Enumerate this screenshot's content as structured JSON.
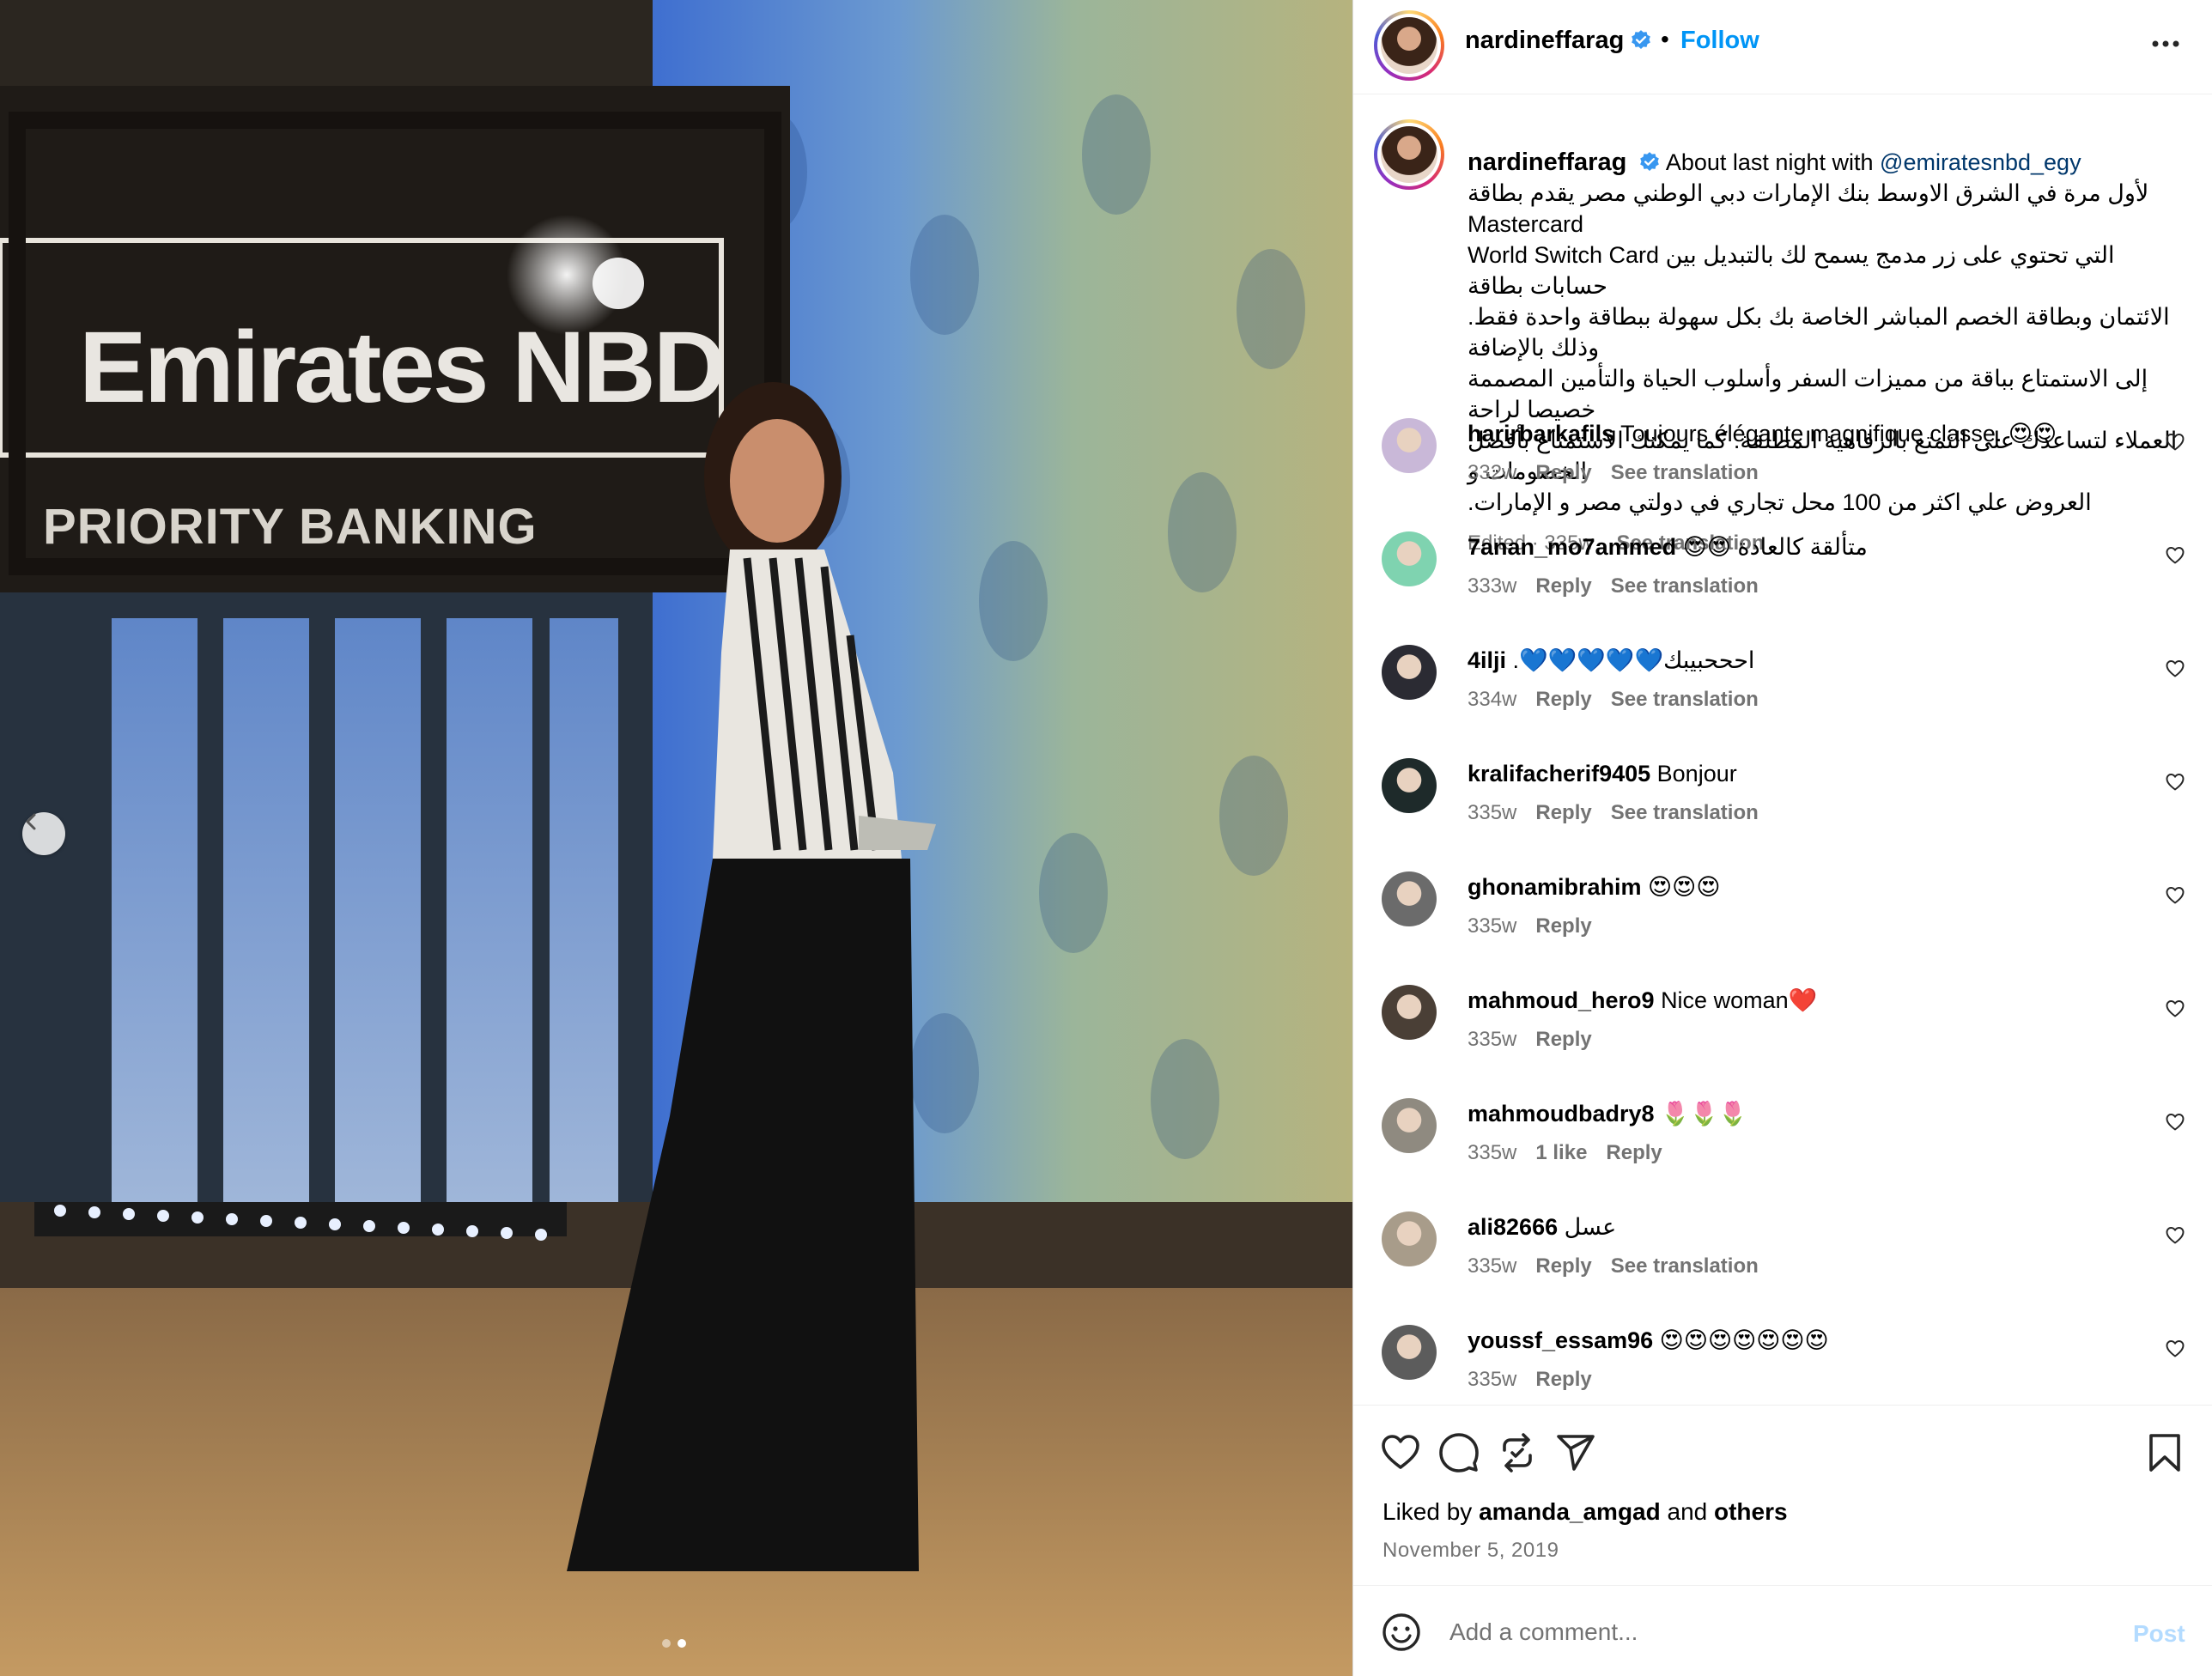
{
  "photo": {
    "sign_title": "Emirates NBD",
    "sign_subtitle": "PRIORITY BANKING",
    "slide_count": 2,
    "active_slide": 2
  },
  "post": {
    "username": "nardineffarag",
    "separator": "•",
    "follow_label": "Follow",
    "caption": {
      "intro": "About last night with",
      "mention": "@emiratesnbd_egy",
      "line1": "لأول مرة في الشرق الاوسط بنك الإمارات دبي الوطني مصر يقدم بطاقة Mastercard",
      "line2": "World Switch Card التي تحتوي على زر مدمج يسمح لك بالتبديل بين حسابات بطاقة",
      "line3": "الائتمان وبطاقة الخصم المباشر الخاصة بك بكل سهولة ببطاقة واحدة فقط. وذلك بالإضافة",
      "line4": "إلى الاستمتاع بباقة من مميزات السفر وأسلوب الحياة والتأمين المصممة خصيصا لراحة",
      "line5": "العملاء لتساعدك على التمتع بالرفاهية المطلقة. كما يمكنك الاستمتاع بأفضل الخصومات و",
      "line6": "العروض علي اكثر من 100 محل تجاري في دولتي مصر و الإمارات."
    },
    "edited": "Edited · 335w",
    "see_translation": "See translation"
  },
  "comments": [
    {
      "user": "harirbarkafils",
      "text": "Toujours élégante magnifique classe. 😍😍",
      "time": "332w",
      "reply": "Reply",
      "translate": "See translation",
      "av": "#c9b8d8"
    },
    {
      "user": "7anan_mo7ammed",
      "text": "😍😍 متألقة كالعادة",
      "time": "333w",
      "reply": "Reply",
      "translate": "See translation",
      "av": "#7fd3b0"
    },
    {
      "user": "4ilji",
      "text": ".💙💙💙💙💙احححبيبك",
      "time": "334w",
      "reply": "Reply",
      "translate": "See translation",
      "av": "#2b2b33"
    },
    {
      "user": "kralifacherif9405",
      "text": "Bonjour",
      "time": "335w",
      "reply": "Reply",
      "translate": "See translation",
      "av": "#1e2a2a"
    },
    {
      "user": "ghonamibrahim",
      "text": "😍😍😍",
      "time": "335w",
      "reply": "Reply",
      "translate": "",
      "av": "#6b6b6b"
    },
    {
      "user": "mahmoud_hero9",
      "text": "Nice woman❤️",
      "time": "335w",
      "reply": "Reply",
      "translate": "",
      "av": "#4a3f36"
    },
    {
      "user": "mahmoudbadry8",
      "text": "🌷🌷🌷",
      "time": "335w",
      "likes": "1 like",
      "reply": "Reply",
      "translate": "",
      "av": "#8f8a80"
    },
    {
      "user": "ali82666",
      "text": "عسل",
      "time": "335w",
      "reply": "Reply",
      "translate": "See translation",
      "av": "#a89c8a"
    },
    {
      "user": "youssf_essam96",
      "text": "😍😍😍😍😍😍😍",
      "time": "335w",
      "reply": "Reply",
      "translate": "",
      "av": "#5c5c5c"
    }
  ],
  "actions": {
    "liked_prefix": "Liked by",
    "liked_user": "amanda_amgad",
    "liked_and": "and",
    "liked_others": "others",
    "date": "November 5, 2019"
  },
  "add_comment": {
    "placeholder": "Add a comment...",
    "post_label": "Post"
  },
  "colors": {
    "accent": "#0095f6",
    "mention": "#00376b",
    "muted": "#737373",
    "post_disabled": "#b3dbff"
  }
}
